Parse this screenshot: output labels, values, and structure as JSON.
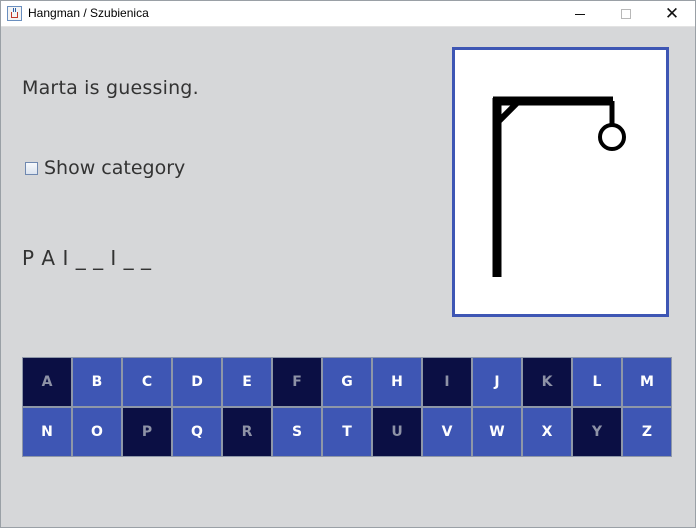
{
  "window": {
    "title": "Hangman / Szubienica"
  },
  "game": {
    "status_text": "Marta is guessing.",
    "show_category_label": "Show category",
    "show_category_checked": false,
    "word_display": "P A I _ _ I _ _",
    "wrong_guesses": 3
  },
  "keyboard": {
    "keys": [
      {
        "letter": "A",
        "used": true
      },
      {
        "letter": "B",
        "used": false
      },
      {
        "letter": "C",
        "used": false
      },
      {
        "letter": "D",
        "used": false
      },
      {
        "letter": "E",
        "used": false
      },
      {
        "letter": "F",
        "used": true
      },
      {
        "letter": "G",
        "used": false
      },
      {
        "letter": "H",
        "used": false
      },
      {
        "letter": "I",
        "used": true
      },
      {
        "letter": "J",
        "used": false
      },
      {
        "letter": "K",
        "used": true
      },
      {
        "letter": "L",
        "used": false
      },
      {
        "letter": "M",
        "used": false
      },
      {
        "letter": "N",
        "used": false
      },
      {
        "letter": "O",
        "used": false
      },
      {
        "letter": "P",
        "used": true
      },
      {
        "letter": "Q",
        "used": false
      },
      {
        "letter": "R",
        "used": true
      },
      {
        "letter": "S",
        "used": false
      },
      {
        "letter": "T",
        "used": false
      },
      {
        "letter": "U",
        "used": true
      },
      {
        "letter": "V",
        "used": false
      },
      {
        "letter": "W",
        "used": false
      },
      {
        "letter": "X",
        "used": false
      },
      {
        "letter": "Y",
        "used": true
      },
      {
        "letter": "Z",
        "used": false
      }
    ]
  },
  "colors": {
    "key_available": "#3e56b4",
    "key_used": "#0b0f44",
    "frame_border": "#3e56b4",
    "background": "#d6d7d9"
  }
}
